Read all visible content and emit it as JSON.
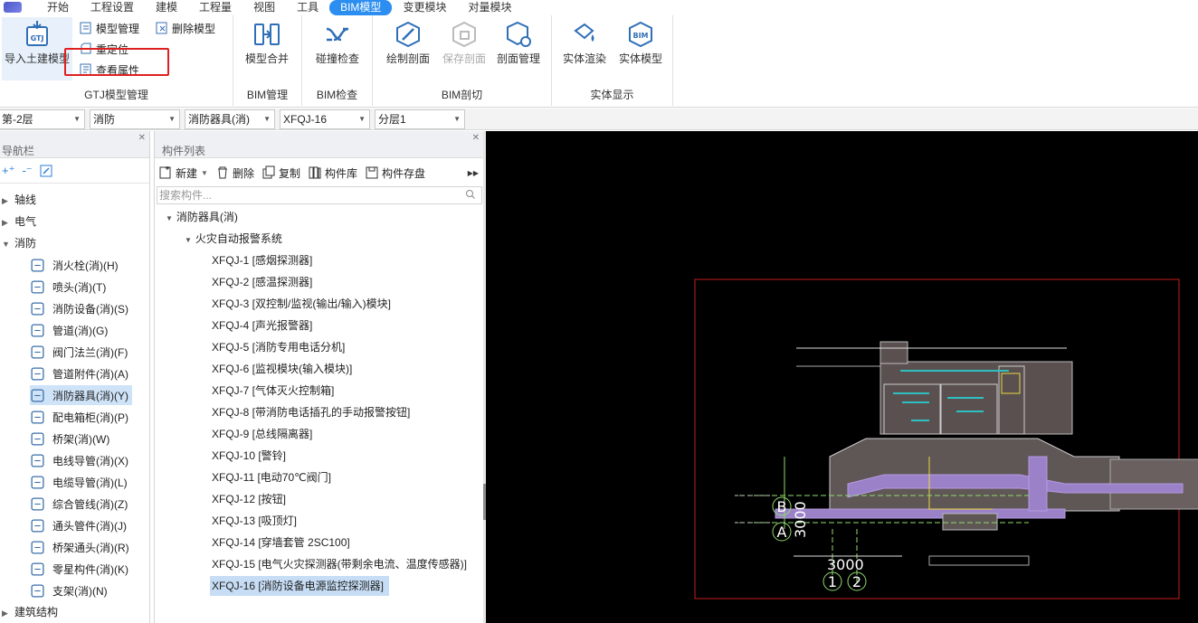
{
  "menu": {
    "items": [
      "开始",
      "工程设置",
      "建模",
      "工程量",
      "视图",
      "工具",
      "BIM模型",
      "变更模块",
      "对量模块"
    ],
    "active_index": 6
  },
  "ribbon": {
    "gtj": {
      "import_label": "导入土建模型",
      "model_manage": "模型管理",
      "delete_model": "删除模型",
      "relocate": "重定位",
      "view_props": "查看属性",
      "title": "GTJ模型管理"
    },
    "bim_manage": {
      "merge": "模型合并",
      "title": "BIM管理"
    },
    "bim_check": {
      "collision": "碰撞检查",
      "title": "BIM检查"
    },
    "bim_section": {
      "draw": "绘制剖面",
      "save": "保存剖面",
      "manage": "剖面管理",
      "title": "BIM剖切"
    },
    "solid_display": {
      "render": "实体渲染",
      "model": "实体模型",
      "title": "实体显示"
    }
  },
  "filters": [
    "第-2层",
    "消防",
    "消防器具(消)",
    "XFQJ-16",
    "分层1"
  ],
  "nav": {
    "title": "导航栏",
    "top_items": [
      "轴线",
      "电气",
      "消防"
    ],
    "children": [
      {
        "label": "消火栓(消)(H)",
        "icon": "hydrant-icon"
      },
      {
        "label": "喷头(消)(T)",
        "icon": "sprinkler-icon"
      },
      {
        "label": "消防设备(消)(S)",
        "icon": "fire-equipment-icon"
      },
      {
        "label": "管道(消)(G)",
        "icon": "pipe-icon"
      },
      {
        "label": "阀门法兰(消)(F)",
        "icon": "valve-icon"
      },
      {
        "label": "管道附件(消)(A)",
        "icon": "pipe-fitting-icon"
      },
      {
        "label": "消防器具(消)(Y)",
        "icon": "alarm-icon"
      },
      {
        "label": "配电箱柜(消)(P)",
        "icon": "distribution-box-icon"
      },
      {
        "label": "桥架(消)(W)",
        "icon": "cable-tray-icon"
      },
      {
        "label": "电线导管(消)(X)",
        "icon": "wire-conduit-icon"
      },
      {
        "label": "电缆导管(消)(L)",
        "icon": "cable-conduit-icon"
      },
      {
        "label": "综合管线(消)(Z)",
        "icon": "combined-pipeline-icon"
      },
      {
        "label": "通头管件(消)(J)",
        "icon": "tee-fitting-icon"
      },
      {
        "label": "桥架通头(消)(R)",
        "icon": "tray-tee-icon"
      },
      {
        "label": "零星构件(消)(K)",
        "icon": "misc-part-icon"
      },
      {
        "label": "支架(消)(N)",
        "icon": "bracket-icon"
      }
    ],
    "selected_child": 6,
    "bottom_item": "建筑结构"
  },
  "components": {
    "title": "构件列表",
    "toolbar": {
      "new": "新建",
      "delete": "删除",
      "copy": "复制",
      "library": "构件库",
      "save": "构件存盘"
    },
    "search_placeholder": "搜索构件...",
    "root": "消防器具(消)",
    "group": "火灾自动报警系统",
    "items": [
      "XFQJ-1 [感烟探测器]",
      "XFQJ-2 [感温探测器]",
      "XFQJ-3 [双控制/监视(输出/输入)模块]",
      "XFQJ-4 [声光报警器]",
      "XFQJ-5 [消防专用电话分机]",
      "XFQJ-6 [监视模块(输入模块)]",
      "XFQJ-7 [气体灭火控制箱]",
      "XFQJ-8 [带消防电话插孔的手动报警按钮]",
      "XFQJ-9 [总线隔离器]",
      "XFQJ-10 [警铃]",
      "XFQJ-11 [电动70℃阀门]",
      "XFQJ-12 [按钮]",
      "XFQJ-13 [吸顶灯]",
      "XFQJ-14 [穿墙套管 2SC100]",
      "XFQJ-15 [电气火灾探测器(带剩余电流、温度传感器)]",
      "XFQJ-16 [消防设备电源监控探测器]"
    ],
    "selected_index": 15
  },
  "drawing": {
    "axis_b": "B",
    "axis_a": "A",
    "axis_1": "1",
    "axis_2": "2",
    "dim_vertical": "3000",
    "dim_horizontal": "3000"
  },
  "colors": {
    "accent": "#2b8ef0",
    "selection": "#cfe3f8",
    "highlight_box": "#e02020",
    "canvas_bg": "#000000"
  }
}
